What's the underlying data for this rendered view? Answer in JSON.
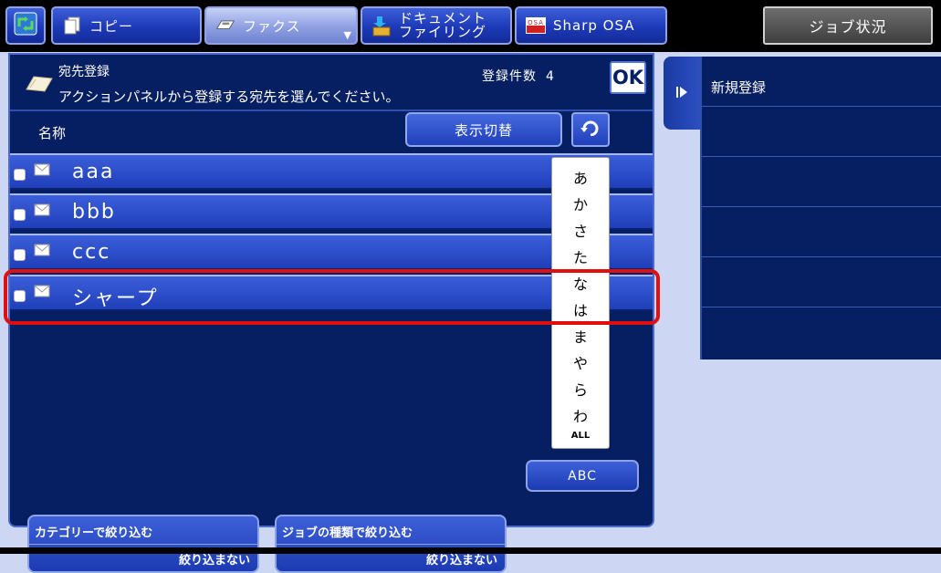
{
  "tabs": {
    "copy_label": "コピー",
    "fax_label": "ファクス",
    "docfiling_line1": "ドキュメント",
    "docfiling_line2": "ファイリング",
    "sharposa_label": "Sharp OSA",
    "osa_icon_text": "OSA",
    "job_status_label": "ジョブ状況"
  },
  "header": {
    "title": "宛先登録",
    "message": "アクションパネルから登録する宛先を選んでください。",
    "count_label": "登録件数",
    "count_value": "4",
    "ok_label": "OK"
  },
  "list": {
    "column_header": "名称",
    "display_toggle_label": "表示切替",
    "rows": [
      {
        "name": "aaa"
      },
      {
        "name": "bbb"
      },
      {
        "name": "ccc"
      },
      {
        "name": "シャープ"
      }
    ]
  },
  "index": {
    "chars": [
      "あ",
      "か",
      "さ",
      "た",
      "な",
      "は",
      "ま",
      "や",
      "ら",
      "わ"
    ],
    "all_label": "ALL"
  },
  "filters": {
    "category_label": "カテゴリーで絞り込む",
    "category_value": "絞り込まない",
    "jobtype_label": "ジョブの種類で絞り込む",
    "jobtype_value": "絞り込まない",
    "abc_label": "ABC"
  },
  "action_panel": {
    "items": [
      "新規登録",
      "",
      "",
      "",
      "",
      ""
    ]
  },
  "colors": {
    "panel_bg": "#061f62",
    "row_blue": "#2a4ccc",
    "highlight_red": "#e01010",
    "page_bg": "#cdd6f2"
  }
}
